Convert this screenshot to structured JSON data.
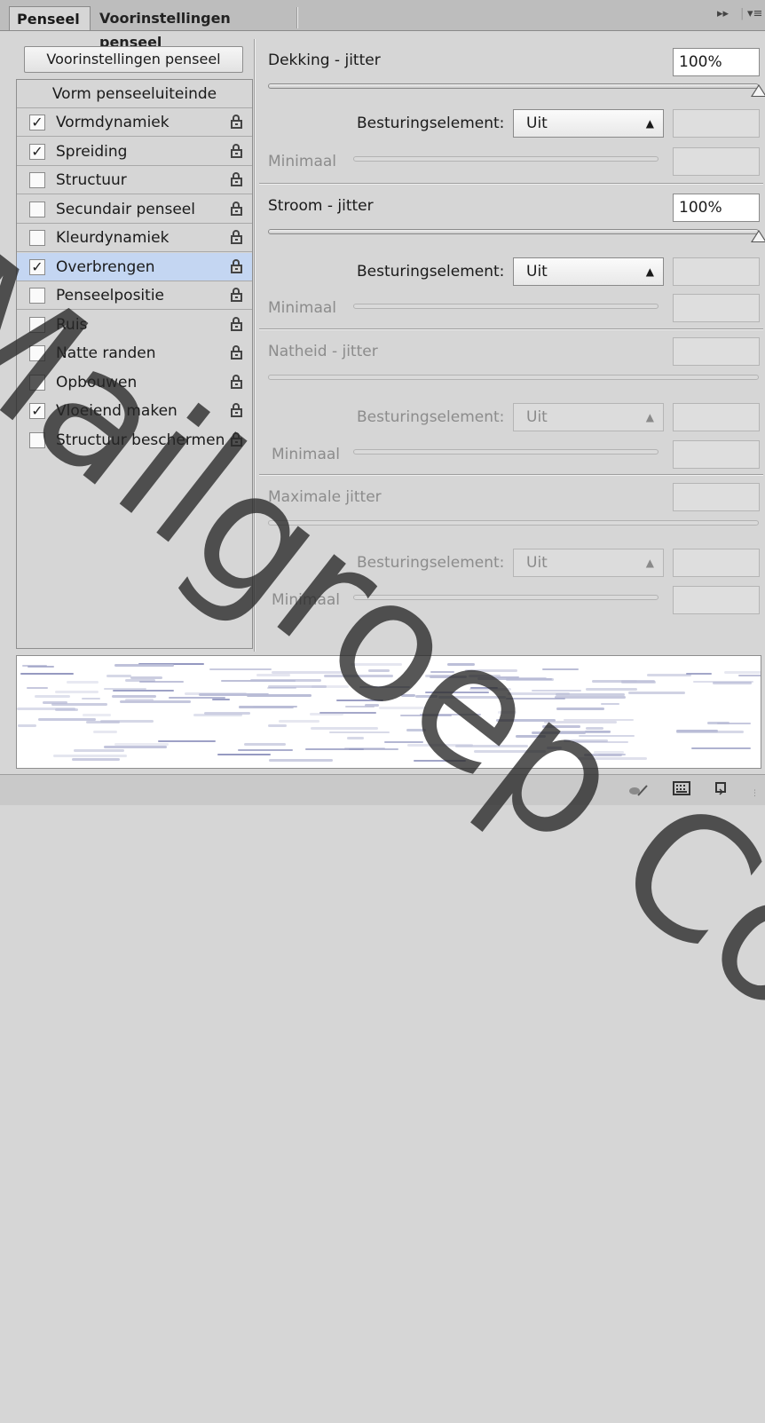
{
  "tabs": [
    {
      "label": "Penseel",
      "active": true
    },
    {
      "label": "Voorinstellingen penseel",
      "active": false
    }
  ],
  "presets_button": "Voorinstellingen penseel",
  "list": {
    "header": "Vorm penseeluiteinde",
    "items": [
      {
        "label": "Vormdynamiek",
        "checked": true,
        "selected": false
      },
      {
        "label": "Spreiding",
        "checked": true,
        "selected": false
      },
      {
        "label": "Structuur",
        "checked": false,
        "selected": false
      },
      {
        "label": "Secundair penseel",
        "checked": false,
        "selected": false
      },
      {
        "label": "Kleurdynamiek",
        "checked": false,
        "selected": false
      },
      {
        "label": "Overbrengen",
        "checked": true,
        "selected": true
      },
      {
        "label": "Penseelpositie",
        "checked": false,
        "selected": false
      },
      {
        "label": "Ruis",
        "checked": false,
        "selected": false
      },
      {
        "label": "Natte randen",
        "checked": false,
        "selected": false
      },
      {
        "label": "Opbouwen",
        "checked": false,
        "selected": false
      },
      {
        "label": "Vloeiend maken",
        "checked": true,
        "selected": false
      },
      {
        "label": "Structuur beschermen",
        "checked": false,
        "selected": false
      }
    ]
  },
  "settings": {
    "opacity": {
      "label": "Dekking - jitter",
      "value": "100%",
      "control_label": "Besturingselement:",
      "control_value": "Uit",
      "min_label": "Minimaal",
      "level": 1.0
    },
    "flow": {
      "label": "Stroom - jitter",
      "value": "100%",
      "control_label": "Besturingselement:",
      "control_value": "Uit",
      "min_label": "Minimaal",
      "level": 1.0
    },
    "wetness": {
      "label": "Natheid - jitter",
      "control_label": "Besturingselement:",
      "control_value": "Uit",
      "min_label": "Minimaal"
    },
    "mix": {
      "label": "Maximale jitter",
      "control_label": "Besturingselement:",
      "control_value": "Uit",
      "min_label": "Minimaal"
    }
  },
  "watermark": "Mailgroep Copyright"
}
